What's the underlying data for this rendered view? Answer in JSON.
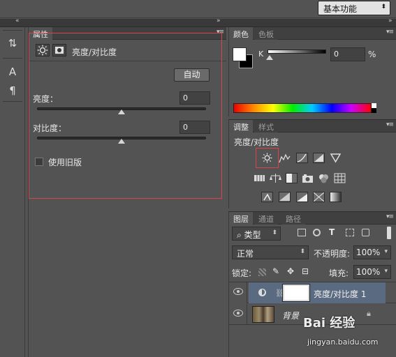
{
  "topbar": {
    "workspace": "基本功能",
    "workspace_arrow": "⬍"
  },
  "strip": {
    "left_arrows": "«",
    "right_arrows": "»"
  },
  "tools": {
    "tool1": "⇅",
    "tool2": "A",
    "tool3": "¶"
  },
  "properties": {
    "tab": "属性",
    "header_title": "亮度/对比度",
    "auto_button": "自动",
    "brightness_label": "亮度：",
    "brightness_value": "0",
    "contrast_label": "对比度：",
    "contrast_value": "0",
    "legacy_label": "使用旧版"
  },
  "color_panel": {
    "tab1": "颜色",
    "tab2": "色板",
    "channel": "K",
    "value": "0",
    "unit": "%",
    "foreground": "#ffffff",
    "background": "#000000"
  },
  "adjustments_panel": {
    "tab1": "调整",
    "tab2": "样式",
    "title": "亮度/对比度"
  },
  "layers_panel": {
    "tab1": "图层",
    "tab2": "通道",
    "tab3": "路径",
    "filter_kind": "类型",
    "blend_mode": "正常",
    "opacity_label": "不透明度:",
    "opacity_value": "100%",
    "lock_label": "锁定:",
    "fill_label": "填充:",
    "fill_value": "100%",
    "layers": [
      {
        "name": "亮度/对比度 1"
      },
      {
        "name": "背景"
      }
    ]
  },
  "watermark": {
    "brand": "Bai 经验",
    "url": "jingyan.baidu.com"
  },
  "colors": {
    "highlight": "#d9434e",
    "panel_bg": "#535353",
    "selected_layer": "#5a6a80"
  }
}
